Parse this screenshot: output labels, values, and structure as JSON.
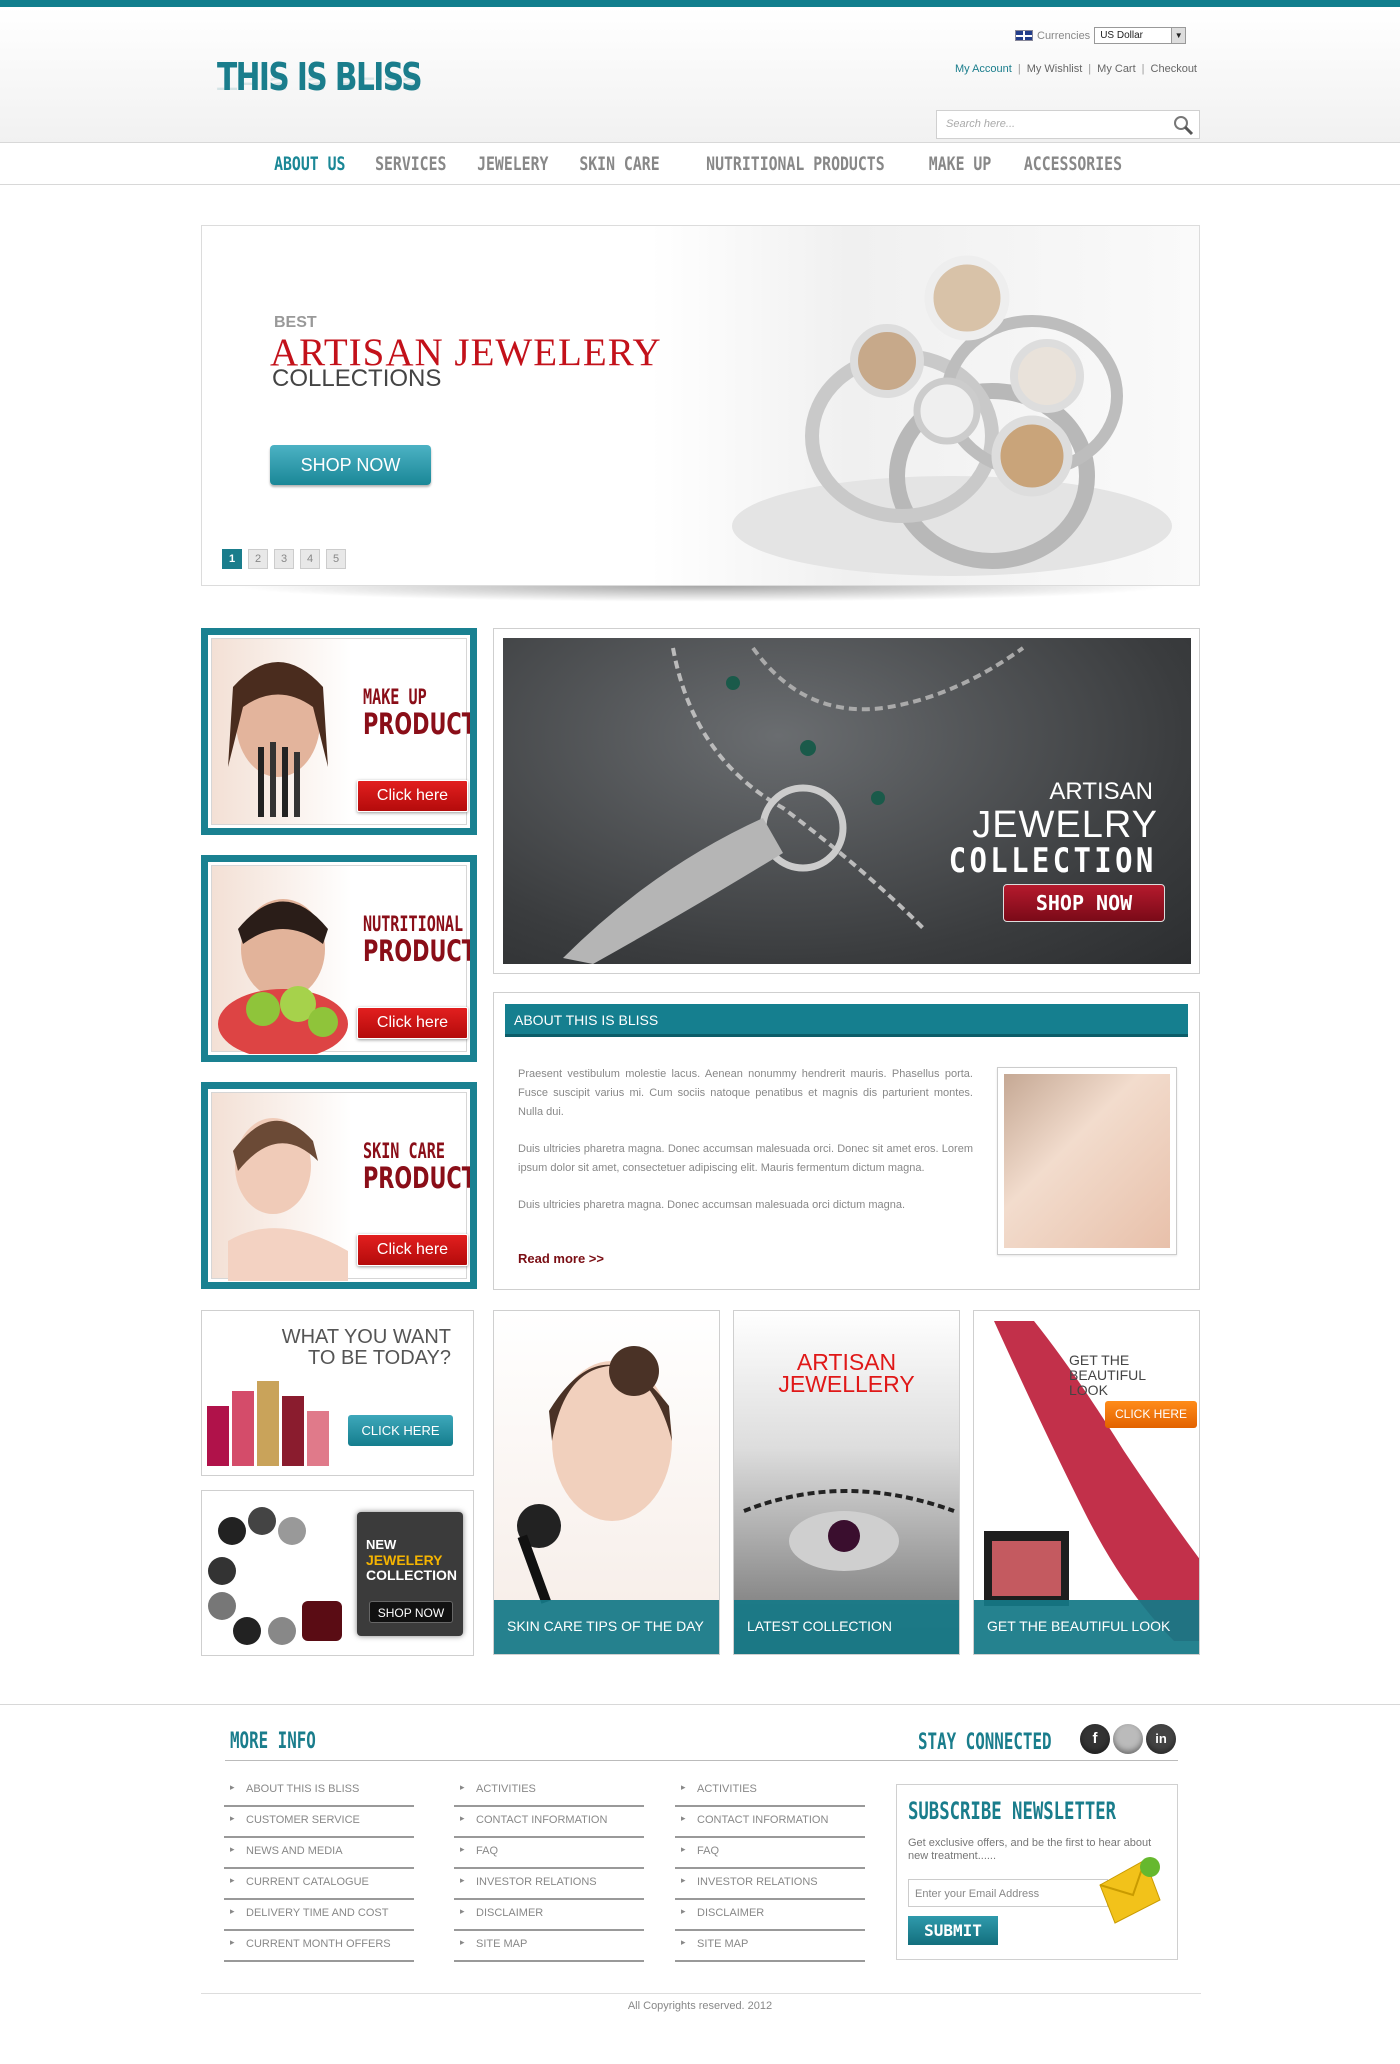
{
  "header": {
    "logo": "THIS IS BLISS",
    "currency_label": "Currencies",
    "currency_value": "US Dollar",
    "account_links": [
      "My Account",
      "My Wishlist",
      "My Cart",
      "Checkout"
    ],
    "search_placeholder": "Search here..."
  },
  "nav": {
    "items": [
      "ABOUT US",
      "SERVICES",
      "JEWELERY",
      "SKIN CARE",
      "NUTRITIONAL PRODUCTS",
      "MAKE UP",
      "ACCESSORIES"
    ],
    "active": "ABOUT US"
  },
  "slider": {
    "kicker": "BEST",
    "title": "ARTISAN JEWELERY",
    "subtitle": "COLLECTIONS",
    "button": "SHOP NOW",
    "pages": [
      "1",
      "2",
      "3",
      "4",
      "5"
    ],
    "current_page": "1"
  },
  "promos": [
    {
      "line1": "MAKE UP",
      "line2": "PRODUCTS",
      "button": "Click here"
    },
    {
      "line1": "NUTRITIONAL",
      "line2": "PRODUCTS",
      "button": "Click here"
    },
    {
      "line1": "SKIN CARE",
      "line2": "PRODUCTS",
      "button": "Click here"
    }
  ],
  "banner": {
    "line1": "ARTISAN",
    "line2": "JEWELRY",
    "line3": "COLLECTION",
    "button": "SHOP NOW"
  },
  "about": {
    "heading": "ABOUT THIS IS BLISS",
    "paragraphs": [
      "Praesent vestibulum molestie lacus. Aenean nonummy hendrerit mauris. Phasellus porta. Fusce suscipit varius mi. Cum sociis natoque penatibus et magnis dis parturient montes. Nulla dui.",
      "Duis ultricies pharetra magna. Donec accumsan malesuada orci. Donec sit amet eros. Lorem ipsum dolor sit amet, consectetuer adipiscing elit. Mauris fermentum dictum magna.",
      "Duis ultricies pharetra magna. Donec accumsan malesuada orci dictum magna."
    ],
    "read_more": "Read more >>"
  },
  "small_ads": {
    "today_q": "WHAT YOU WANT TO BE TODAY?",
    "today_btn": "CLICK HERE",
    "new_l1": "NEW",
    "new_l2": "JEWELERY",
    "new_l3": "COLLECTION",
    "new_btn": "SHOP NOW"
  },
  "tiles": [
    {
      "caption": "SKIN CARE TIPS OF THE DAY"
    },
    {
      "title": "ARTISAN JEWELLERY",
      "caption": "LATEST COLLECTION"
    },
    {
      "title": "GET THE BEAUTIFUL LOOK",
      "button": "CLICK HERE",
      "caption": "GET THE BEAUTIFUL LOOK"
    }
  ],
  "footer": {
    "more_info": "MORE INFO",
    "stay_connected": "STAY CONNECTED",
    "col1": [
      "ABOUT THIS IS BLISS",
      "CUSTOMER SERVICE",
      "NEWS AND MEDIA",
      "CURRENT CATALOGUE",
      "DELIVERY TIME AND COST",
      "CURRENT MONTH OFFERS"
    ],
    "col2": [
      "ACTIVITIES",
      "CONTACT INFORMATION",
      "FAQ",
      "INVESTOR RELATIONS",
      "DISCLAIMER",
      "SITE MAP"
    ],
    "col3": [
      "ACTIVITIES",
      "CONTACT INFORMATION",
      "FAQ",
      "INVESTOR RELATIONS",
      "DISCLAIMER",
      "SITE MAP"
    ],
    "social": [
      "f",
      "in"
    ],
    "newsletter": {
      "title": "SUBSCRIBE NEWSLETTER",
      "desc": "Get exclusive offers, and be the first to hear about new treatment......",
      "placeholder": "Enter your Email Address",
      "button": "SUBMIT"
    },
    "copyright": "All Copyrights reserved. 2012"
  },
  "colors": {
    "accent": "#1a7d8c",
    "brand_red": "#c3111a",
    "cta_red": "#d31515",
    "cta_orange": "#f07a10"
  }
}
